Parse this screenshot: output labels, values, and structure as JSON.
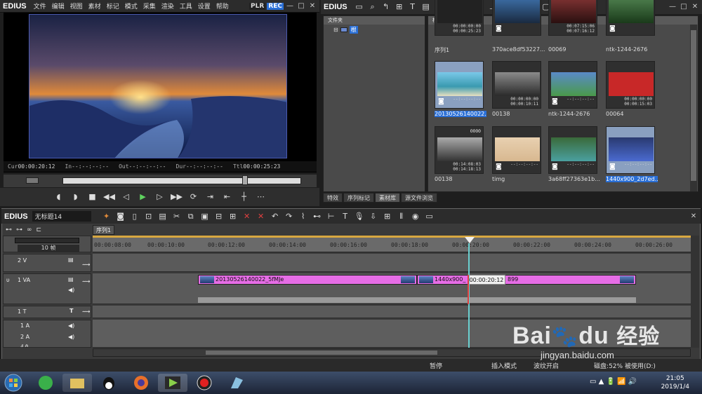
{
  "app": {
    "logo": "EDIUS",
    "menu": [
      "文件",
      "编辑",
      "视图",
      "素材",
      "标记",
      "模式",
      "采集",
      "渲染",
      "工具",
      "设置",
      "帮助"
    ],
    "plr": "PLR",
    "rec": "REC"
  },
  "player": {
    "cur_label": "Cur",
    "cur": "00:00:20:12",
    "in_label": "In",
    "in": "--:--:--:--",
    "out_label": "Out",
    "out": "--:--:--:--",
    "dur_label": "Dur",
    "dur": "--:--:--:--",
    "ttl_label": "Ttl",
    "ttl": "00:00:25:23"
  },
  "bin": {
    "logo": "EDIUS",
    "folder_header": "文件夹",
    "root_label": "根",
    "bin_header": "根 (2/12)",
    "items": [
      {
        "label": "序列1",
        "tc": "00:00:00:00\n00:00:25:23",
        "selected": false
      },
      {
        "label": "370ace8df53227...",
        "tc": "",
        "selected": false
      },
      {
        "label": "00069",
        "tc": "00:07:15:06\n00:07:16:12",
        "selected": false
      },
      {
        "label": "ntk-1244-2676",
        "tc": "",
        "selected": false
      },
      {
        "label": "20130526140022...",
        "tc": "--:--:--:--",
        "selected": true
      },
      {
        "label": "00138",
        "tc": "00:00:00:00\n00:00:10:11",
        "selected": false
      },
      {
        "label": "ntk-1244-2676",
        "tc": "--:--:--:--",
        "selected": false
      },
      {
        "label": "00064",
        "tc": "00:00:00:00\n00:00:15:03",
        "selected": false
      },
      {
        "label": "00138",
        "tc": "00:14:08:03\n00:14:18:13",
        "selected": false
      },
      {
        "label": "timg",
        "tc": "--:--:--:--",
        "selected": false
      },
      {
        "label": "3a68ff27363e1b...",
        "tc": "--:--:--:--",
        "selected": false
      },
      {
        "label": "1440x900_2d7ed...",
        "tc": "--:--:--:--",
        "selected": true
      }
    ],
    "thumb_badge": "0000",
    "tabs": [
      "特效",
      "序列标记",
      "素材库",
      "源文件浏览"
    ]
  },
  "timeline": {
    "logo": "EDIUS",
    "project": "无标题14",
    "seq_tab": "序列1",
    "zoom": "10 帧",
    "ruler": [
      "00:00:08:00",
      "00:00:10:00",
      "00:00:12:00",
      "00:00:14:00",
      "00:00:16:00",
      "00:00:18:00",
      "00:00:20:00",
      "00:00:22:00",
      "00:00:24:00",
      "00:00:26:00"
    ],
    "tracks": {
      "v2": "2 V",
      "va1": "1 VA",
      "t1": "1 T",
      "a1": "1 A",
      "a2": "2 A",
      "a3": "3 A"
    },
    "clip1": "20130526140022_5fMJe",
    "clip2a": "1440x900_",
    "clip2b": "899",
    "tooltip": "00:00:20:12"
  },
  "status": {
    "s1": "暂停",
    "s2": "插入模式",
    "s3": "波纹开启",
    "s4": "磁盘:52% 被使用(D:)"
  },
  "taskbar": {
    "time": "21:05",
    "date": "2019/1/4"
  },
  "watermark": {
    "brand": "Bai",
    "brand2": "du",
    "cn": "经验",
    "url": "jingyan.baidu.com"
  },
  "colors": {
    "accent": "#2a6fd6",
    "clip": "#e66de6",
    "playhead": "#e04040"
  }
}
